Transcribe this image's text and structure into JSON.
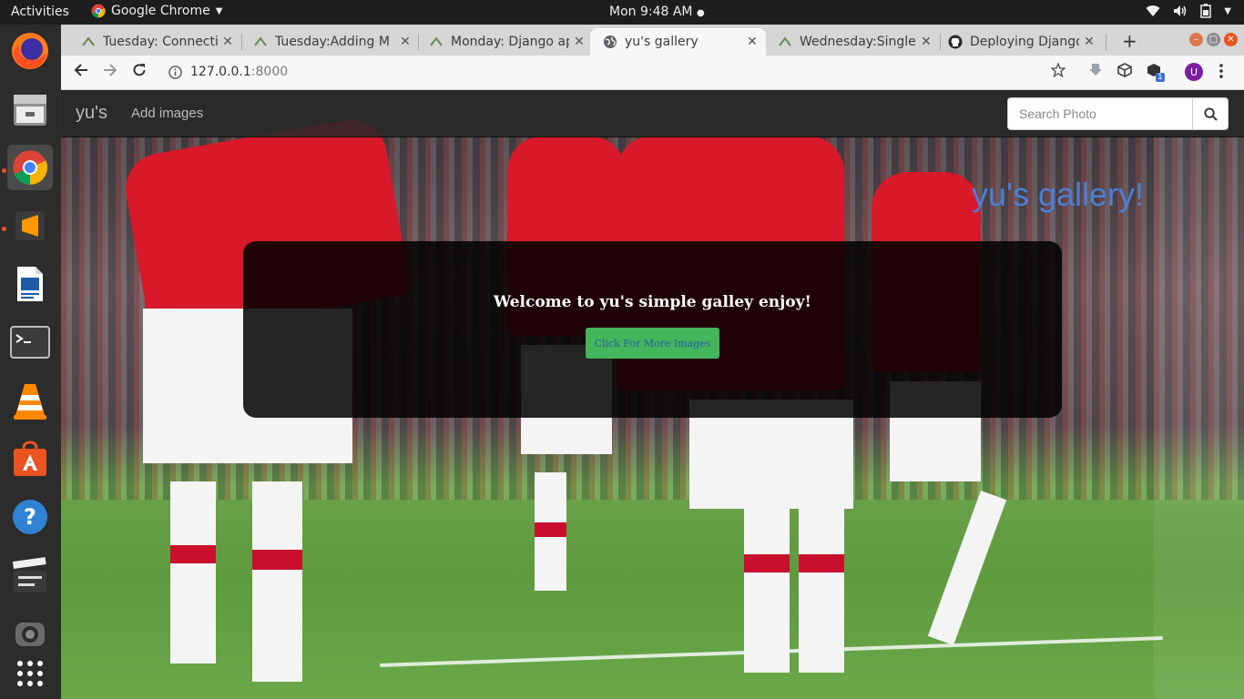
{
  "system_bar": {
    "activities": "Activities",
    "app_name": "Google Chrome",
    "clock": "Mon  9:48 AM"
  },
  "dock": {
    "items": [
      "firefox-icon",
      "files-icon",
      "chrome-icon",
      "sublime-text-icon",
      "writer-icon",
      "terminal-icon",
      "vlc-icon",
      "software-center-icon",
      "help-icon",
      "video-editor-icon",
      "webcam-icon",
      "app-grid-icon"
    ]
  },
  "tabs": [
    {
      "title": "Tuesday: Connecti",
      "active": false
    },
    {
      "title": "Tuesday:Adding M",
      "active": false
    },
    {
      "title": "Monday: Django ap",
      "active": false
    },
    {
      "title": "yu's gallery",
      "active": true
    },
    {
      "title": "Wednesday:Single",
      "active": false
    },
    {
      "title": "Deploying Django",
      "active": false
    }
  ],
  "toolbar": {
    "url_host": "127.0.0.1",
    "url_port": ":8000",
    "extension_badge": "1",
    "profile_initial": "U"
  },
  "site": {
    "brand": "yu's",
    "nav_link": "Add images",
    "search_placeholder": "Search Photo",
    "gallery_title": "yu's gallery!",
    "welcome": "Welcome to yu's simple galley enjoy!",
    "cta_button": "Click For More Images"
  },
  "colors": {
    "accent_button": "#43b55b",
    "button_text": "#2a5da8",
    "gallery_title": "#4a7fd6"
  }
}
